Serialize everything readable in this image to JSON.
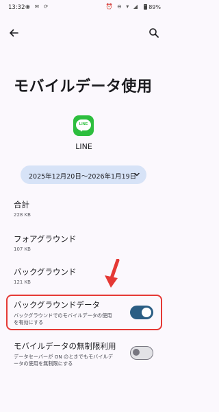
{
  "status_bar": {
    "time": "13:32",
    "left_icons": "◉ ✉ ⟳",
    "right_icons": "⏰ ⊖ ▾ ◢",
    "battery": "89%"
  },
  "header": {
    "title": "モバイルデータ使用",
    "back_icon": "arrow-left",
    "search_icon": "magnifier"
  },
  "app": {
    "icon_name": "line-logo",
    "icon_text": "LINE",
    "name": "LINE",
    "brand_color": "#2dbe3e"
  },
  "date_range": {
    "label": "2025年12月20日〜2026年1月19日"
  },
  "usage": [
    {
      "label": "合計",
      "value": "228 KB"
    },
    {
      "label": "フォアグラウンド",
      "value": "107 KB"
    },
    {
      "label": "バックグラウンド",
      "value": "121 KB"
    }
  ],
  "toggles": [
    {
      "title": "バックグラウンドデータ",
      "summary": "バックグラウンドでのモバイルデータの使用を有効にする",
      "enabled": true
    },
    {
      "title": "モバイルデータの無制限利用",
      "summary": "データセーバーが ON のときでもモバイルデータの使用を無制限にする",
      "enabled": false
    }
  ],
  "annotation": {
    "color": "#e53935"
  }
}
